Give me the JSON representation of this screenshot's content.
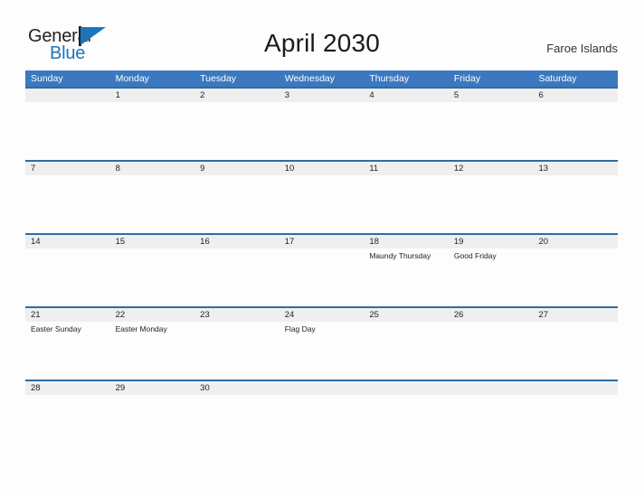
{
  "brand": {
    "name_part1": "General",
    "name_part2": "Blue",
    "primary_color": "#1b75bb",
    "dark_color": "#231f20",
    "triangle_icon": "triangle-icon"
  },
  "header": {
    "title": "April 2030",
    "locale": "Faroe Islands"
  },
  "calendar": {
    "header_bg": "#3c78bf",
    "date_band_bg": "#efefef",
    "rule_color": "#2e6da4",
    "weekdays": [
      "Sunday",
      "Monday",
      "Tuesday",
      "Wednesday",
      "Thursday",
      "Friday",
      "Saturday"
    ],
    "weeks": [
      {
        "days": [
          {
            "date": "",
            "event": ""
          },
          {
            "date": "1",
            "event": ""
          },
          {
            "date": "2",
            "event": ""
          },
          {
            "date": "3",
            "event": ""
          },
          {
            "date": "4",
            "event": ""
          },
          {
            "date": "5",
            "event": ""
          },
          {
            "date": "6",
            "event": ""
          }
        ]
      },
      {
        "days": [
          {
            "date": "7",
            "event": ""
          },
          {
            "date": "8",
            "event": ""
          },
          {
            "date": "9",
            "event": ""
          },
          {
            "date": "10",
            "event": ""
          },
          {
            "date": "11",
            "event": ""
          },
          {
            "date": "12",
            "event": ""
          },
          {
            "date": "13",
            "event": ""
          }
        ]
      },
      {
        "days": [
          {
            "date": "14",
            "event": ""
          },
          {
            "date": "15",
            "event": ""
          },
          {
            "date": "16",
            "event": ""
          },
          {
            "date": "17",
            "event": ""
          },
          {
            "date": "18",
            "event": "Maundy Thursday"
          },
          {
            "date": "19",
            "event": "Good Friday"
          },
          {
            "date": "20",
            "event": ""
          }
        ]
      },
      {
        "days": [
          {
            "date": "21",
            "event": "Easter Sunday"
          },
          {
            "date": "22",
            "event": "Easter Monday"
          },
          {
            "date": "23",
            "event": ""
          },
          {
            "date": "24",
            "event": "Flag Day"
          },
          {
            "date": "25",
            "event": ""
          },
          {
            "date": "26",
            "event": ""
          },
          {
            "date": "27",
            "event": ""
          }
        ]
      },
      {
        "days": [
          {
            "date": "28",
            "event": ""
          },
          {
            "date": "29",
            "event": ""
          },
          {
            "date": "30",
            "event": ""
          },
          {
            "date": "",
            "event": ""
          },
          {
            "date": "",
            "event": ""
          },
          {
            "date": "",
            "event": ""
          },
          {
            "date": "",
            "event": ""
          }
        ]
      }
    ]
  }
}
